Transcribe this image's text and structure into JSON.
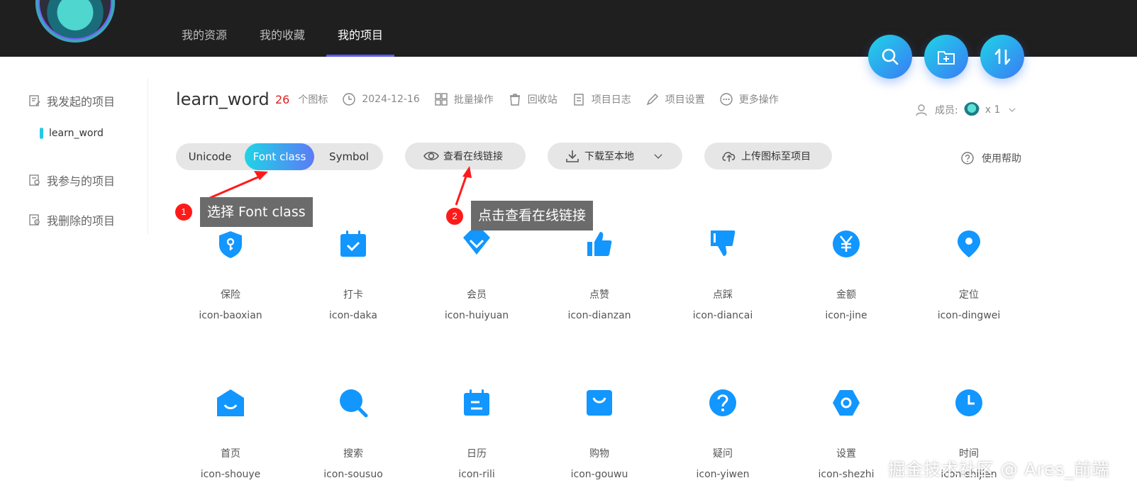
{
  "colors": {
    "accent": "#1296ff",
    "gradient_start": "#1fd4e6",
    "gradient_end": "#3a7bf5",
    "count_red": "#e02020",
    "annotation_red": "#ff1a1a",
    "topbar": "#1f1f1f"
  },
  "topnav": {
    "items": [
      {
        "label": "我的资源"
      },
      {
        "label": "我的收藏"
      },
      {
        "label": "我的项目"
      }
    ],
    "active": "我的项目"
  },
  "top_actions": [
    {
      "icon": "search-icon"
    },
    {
      "icon": "add-folder-icon"
    },
    {
      "icon": "sort-icon"
    }
  ],
  "sidebar": {
    "started": "我发起的项目",
    "current_project": "learn_word",
    "joined": "我参与的项目",
    "deleted": "我删除的项目"
  },
  "header": {
    "title": "learn_word",
    "count": "26",
    "count_unit": "个图标",
    "date": "2024-12-16",
    "batch": "批量操作",
    "recycle": "回收站",
    "log": "项目日志",
    "settings": "项目设置",
    "more": "更多操作",
    "members_label": "成员:",
    "members_count": "x 1"
  },
  "toolbar": {
    "tabs": [
      "Unicode",
      "Font class",
      "Symbol"
    ],
    "active_tab": "Font class",
    "view_link": "查看在线链接",
    "download": "下载至本地",
    "upload": "上传图标至项目",
    "help": "使用帮助"
  },
  "annotations": [
    {
      "number": "1",
      "text": "选择 Font class"
    },
    {
      "number": "2",
      "text": "点击查看在线链接"
    }
  ],
  "icons": [
    {
      "name": "保险",
      "code": "icon-baoxian",
      "glyph": "shield-icon"
    },
    {
      "name": "打卡",
      "code": "icon-daka",
      "glyph": "calendar-check-icon"
    },
    {
      "name": "会员",
      "code": "icon-huiyuan",
      "glyph": "diamond-icon"
    },
    {
      "name": "点赞",
      "code": "icon-dianzan",
      "glyph": "thumbs-up-icon"
    },
    {
      "name": "点踩",
      "code": "icon-diancai",
      "glyph": "thumbs-down-icon"
    },
    {
      "name": "金额",
      "code": "icon-jine",
      "glyph": "yen-icon"
    },
    {
      "name": "定位",
      "code": "icon-dingwei",
      "glyph": "location-pin-icon"
    },
    {
      "name": "首页",
      "code": "icon-shouye",
      "glyph": "home-icon"
    },
    {
      "name": "搜索",
      "code": "icon-sousuo",
      "glyph": "search-icon"
    },
    {
      "name": "日历",
      "code": "icon-rili",
      "glyph": "calendar-icon"
    },
    {
      "name": "购物",
      "code": "icon-gouwu",
      "glyph": "shopping-bag-icon"
    },
    {
      "name": "疑问",
      "code": "icon-yiwen",
      "glyph": "question-icon"
    },
    {
      "name": "设置",
      "code": "icon-shezhi",
      "glyph": "settings-hexagon-icon"
    },
    {
      "name": "时间",
      "code": "icon-shijian",
      "glyph": "clock-icon"
    }
  ],
  "watermark": "掘金技术社区 @ Ares_前端"
}
